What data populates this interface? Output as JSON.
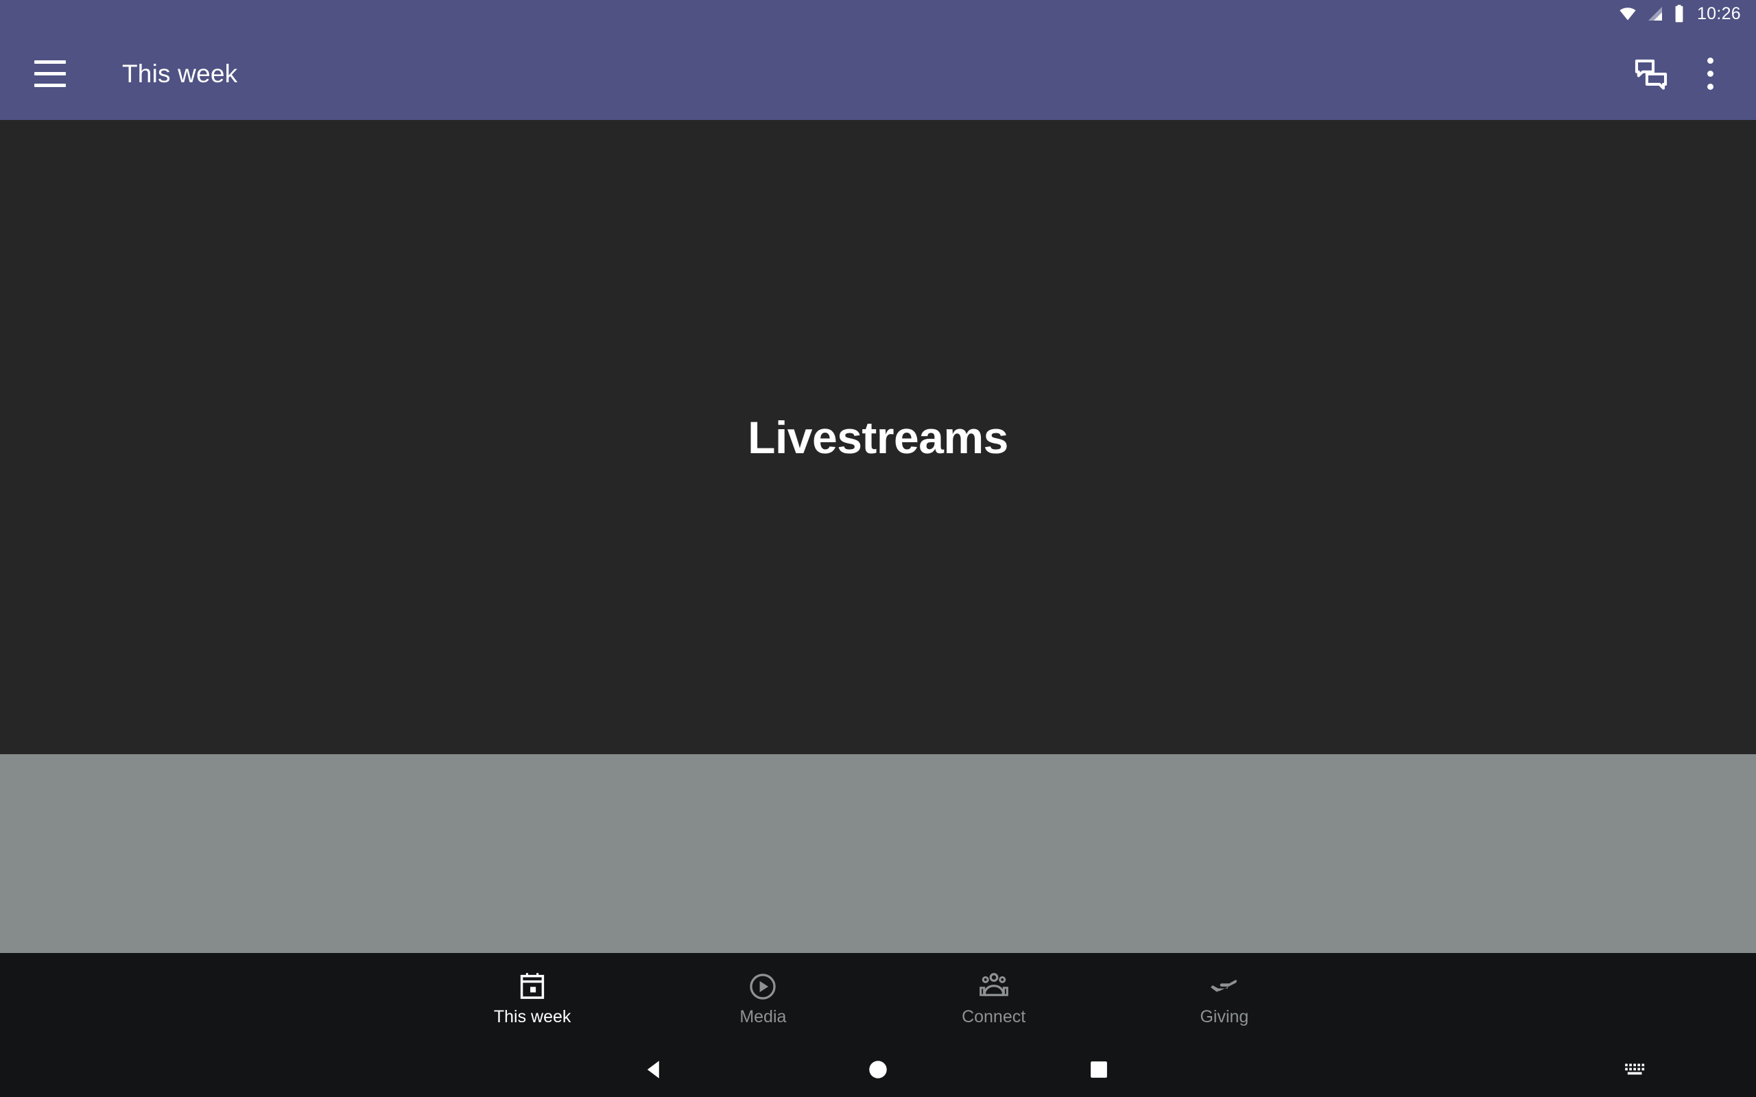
{
  "status_bar": {
    "time": "10:26",
    "background_color": "#4f5283",
    "icons": [
      {
        "name": "wifi-icon",
        "label": "wifi"
      },
      {
        "name": "cellular-signal-icon",
        "label": "cellular signal"
      },
      {
        "name": "battery-icon",
        "label": "battery"
      }
    ]
  },
  "toolbar": {
    "title": "This week",
    "background_color": "#4f5283",
    "menu_icon": "hamburger-menu-icon",
    "actions": [
      {
        "name": "chat-bubbles-icon",
        "label": "Chat"
      },
      {
        "name": "overflow-menu-icon",
        "label": "More options"
      }
    ]
  },
  "content": {
    "heading": "Livestreams",
    "background_color": "#262626",
    "panel_color": "#868b8b"
  },
  "bottom_nav": {
    "background_color": "#121415",
    "active_color": "#ffffff",
    "inactive_color": "#8e9294",
    "tabs": [
      {
        "label": "This week",
        "icon": "calendar-icon",
        "active": true
      },
      {
        "label": "Media",
        "icon": "play-circle-icon",
        "active": false
      },
      {
        "label": "Connect",
        "icon": "people-group-icon",
        "active": false
      },
      {
        "label": "Giving",
        "icon": "hand-offering-icon",
        "active": false
      }
    ]
  },
  "system_nav": {
    "background_color": "#121415",
    "buttons": [
      {
        "name": "back-icon",
        "label": "Back"
      },
      {
        "name": "home-icon",
        "label": "Home"
      },
      {
        "name": "recents-icon",
        "label": "Recent apps"
      },
      {
        "name": "keyboard-icon",
        "label": "Switch keyboard"
      }
    ]
  }
}
